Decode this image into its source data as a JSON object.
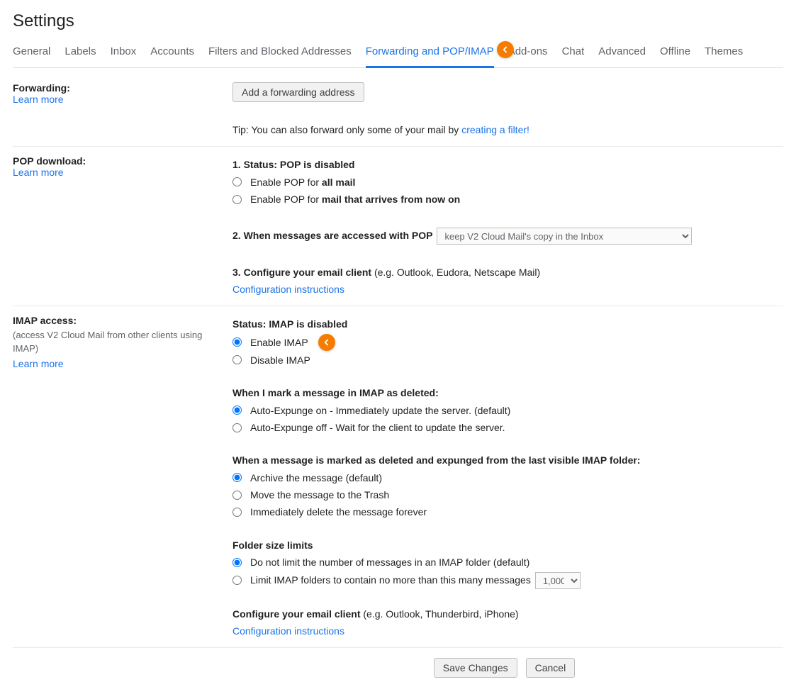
{
  "pageTitle": "Settings",
  "tabs": [
    "General",
    "Labels",
    "Inbox",
    "Accounts",
    "Filters and Blocked Addresses",
    "Forwarding and POP/IMAP",
    "Add-ons",
    "Chat",
    "Advanced",
    "Offline",
    "Themes"
  ],
  "activeTabIndex": 5,
  "forwarding": {
    "heading": "Forwarding:",
    "learnMore": "Learn more",
    "addButton": "Add a forwarding address",
    "tipPrefix": "Tip: You can also forward only some of your mail by ",
    "tipLink": "creating a filter!"
  },
  "pop": {
    "heading": "POP download:",
    "learnMore": "Learn more",
    "statusLabel": "1. Status: ",
    "statusValue": "POP is disabled",
    "opt1prefix": "Enable POP for ",
    "opt1bold": "all mail",
    "opt2prefix": "Enable POP for ",
    "opt2bold": "mail that arrives from now on",
    "step2": "2. When messages are accessed with POP ",
    "popSelectOption": "keep V2 Cloud Mail's copy in the Inbox",
    "step3a": "3. Configure your email client ",
    "step3b": "(e.g. Outlook, Eudora, Netscape Mail)",
    "configLink": "Configuration instructions"
  },
  "imap": {
    "heading": "IMAP access:",
    "sub": "(access V2 Cloud Mail from other clients using IMAP)",
    "learnMore": "Learn more",
    "statusLabel": "Status: ",
    "statusValue": "IMAP is disabled",
    "enable": "Enable IMAP",
    "disable": "Disable IMAP",
    "deletedHead": "When I mark a message in IMAP as deleted:",
    "expungeOn": "Auto-Expunge on - Immediately update the server. (default)",
    "expungeOff": "Auto-Expunge off - Wait for the client to update the server.",
    "lastFolderHead": "When a message is marked as deleted and expunged from the last visible IMAP folder:",
    "archive": "Archive the message (default)",
    "trash": "Move the message to the Trash",
    "deleteForever": "Immediately delete the message forever",
    "folderHead": "Folder size limits",
    "noLimit": "Do not limit the number of messages in an IMAP folder (default)",
    "limitPrefix": "Limit IMAP folders to contain no more than this many messages ",
    "limitSelectOption": "1,000",
    "configureA": "Configure your email client ",
    "configureB": "(e.g. Outlook, Thunderbird, iPhone)",
    "configLink": "Configuration instructions"
  },
  "footer": {
    "save": "Save Changes",
    "cancel": "Cancel"
  }
}
